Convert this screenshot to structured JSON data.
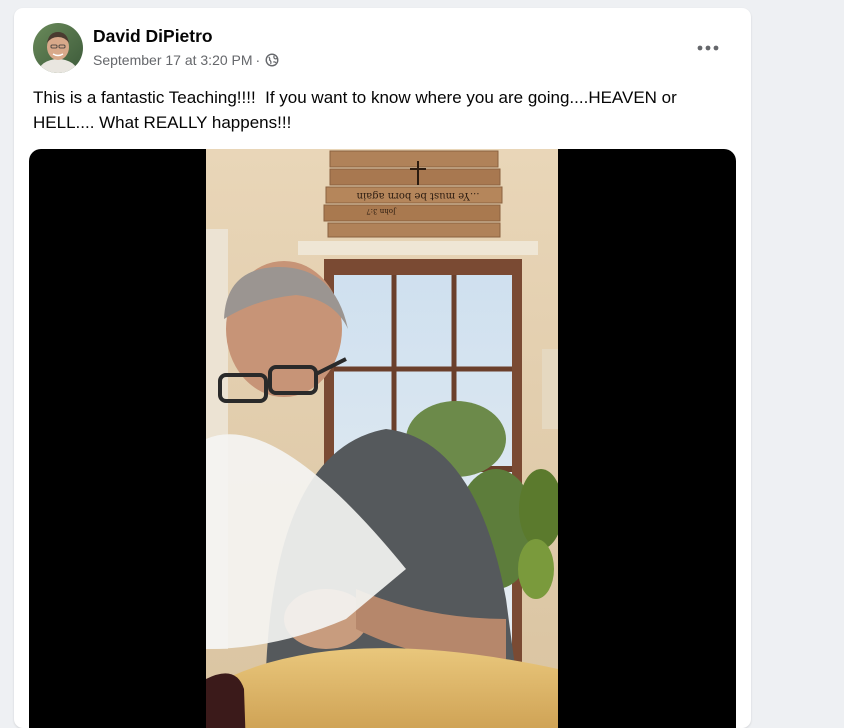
{
  "post": {
    "author": "David DiPietro",
    "date": "September 17 at 3:20 PM",
    "separator": "·",
    "privacy_icon": "globe-icon",
    "more_icon": "more-options-icon",
    "text": "This is a fantastic Teaching!!!!  If you want to know where you are going....HEAVEN or\nHELL.... What REALLY happens!!!"
  },
  "video": {
    "sign_line1": "...Ye must be born again",
    "sign_line2": "John 3:7"
  },
  "colors": {
    "card_bg": "#ffffff",
    "page_bg": "#eef0f3",
    "name_text": "#050505",
    "meta_text": "#65676b",
    "video_bg": "#000000"
  }
}
